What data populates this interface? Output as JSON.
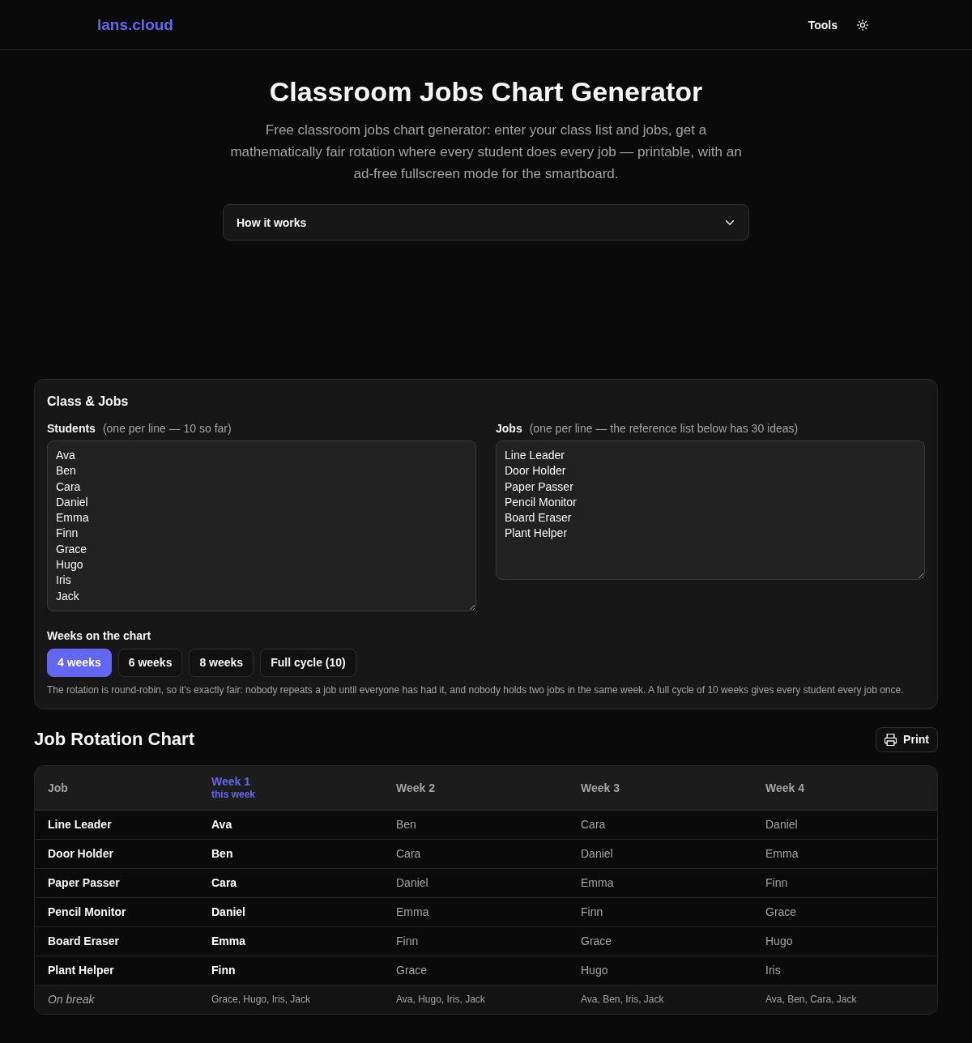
{
  "nav": {
    "logo": "lans.cloud",
    "links": [
      "Tools"
    ]
  },
  "hero": {
    "title": "Classroom Jobs Chart Generator",
    "description": "Free classroom jobs chart generator: enter your class list and jobs, get a mathematically fair rotation where every student does every job — printable, with an ad-free fullscreen mode for the smartboard.",
    "accordion": {
      "label": "How it works",
      "expanded": false
    }
  },
  "class_jobs": {
    "title": "Class & Jobs",
    "students": {
      "label": "Students",
      "note": "(one per line — 10 so far)",
      "value": "Ava\nBen\nCara\nDaniel\nEmma\nFinn\nGrace\nHugo\nIris\nJack"
    },
    "jobs": {
      "label": "Jobs",
      "note": "(one per line — the reference list below has 30 ideas)",
      "value": "Line Leader\nDoor Holder\nPaper Passer\nPencil Monitor\nBoard Eraser\nPlant Helper"
    },
    "weeks": {
      "label": "Weeks on the chart",
      "options": [
        {
          "label": "4 weeks",
          "selected": true
        },
        {
          "label": "6 weeks",
          "selected": false
        },
        {
          "label": "8 weeks",
          "selected": false
        },
        {
          "label": "Full cycle (10)",
          "selected": false
        }
      ]
    },
    "note": "The rotation is round-robin, so it's exactly fair: nobody repeats a job until everyone has had it, and nobody holds two jobs in the same week. A full cycle of 10 weeks gives every student every job once."
  },
  "chart": {
    "title": "Job Rotation Chart",
    "print_button": "Print",
    "job_column": "Job",
    "weeks": [
      {
        "label": "Week 1",
        "sublabel": "this week",
        "current": true
      },
      {
        "label": "Week 2",
        "current": false
      },
      {
        "label": "Week 3",
        "current": false
      },
      {
        "label": "Week 4",
        "current": false
      }
    ],
    "rows": [
      {
        "kind": "job",
        "label": "Line Leader",
        "cells": [
          "Ava",
          "Ben",
          "Cara",
          "Daniel"
        ]
      },
      {
        "kind": "job",
        "label": "Door Holder",
        "cells": [
          "Ben",
          "Cara",
          "Daniel",
          "Emma"
        ]
      },
      {
        "kind": "job",
        "label": "Paper Passer",
        "cells": [
          "Cara",
          "Daniel",
          "Emma",
          "Finn"
        ]
      },
      {
        "kind": "job",
        "label": "Pencil Monitor",
        "cells": [
          "Daniel",
          "Emma",
          "Finn",
          "Grace"
        ]
      },
      {
        "kind": "job",
        "label": "Board Eraser",
        "cells": [
          "Emma",
          "Finn",
          "Grace",
          "Hugo"
        ]
      },
      {
        "kind": "job",
        "label": "Plant Helper",
        "cells": [
          "Finn",
          "Grace",
          "Hugo",
          "Iris"
        ]
      },
      {
        "kind": "break",
        "label": "On break",
        "cells": [
          "Grace, Hugo, Iris, Jack",
          "Ava, Hugo, Iris, Jack",
          "Ava, Ben, Iris, Jack",
          "Ava, Ben, Cara, Jack"
        ]
      }
    ]
  }
}
